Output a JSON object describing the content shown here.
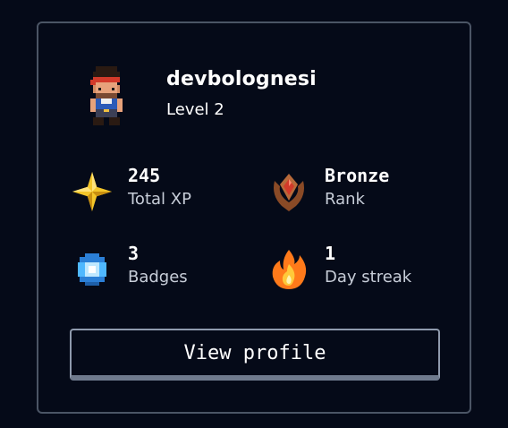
{
  "user": {
    "username": "devbolognesi",
    "level": "Level 2"
  },
  "stats": [
    {
      "value": "245",
      "label": "Total XP",
      "icon": "sparkle-icon"
    },
    {
      "value": "Bronze",
      "label": "Rank",
      "icon": "rank-emblem-icon"
    },
    {
      "value": "3",
      "label": "Badges",
      "icon": "gem-icon"
    },
    {
      "value": "1",
      "label": "Day streak",
      "icon": "flame-icon"
    }
  ],
  "actions": {
    "view_profile_label": "View profile"
  },
  "colors": {
    "background": "#050a18",
    "card_border": "#4b5565",
    "button_border": "#8f9aad",
    "text_primary": "#ffffff",
    "text_secondary": "#c7cdd8",
    "xp_gold": "#f4c62a",
    "gem_blue": "#4fb8ff",
    "flame_orange": "#ff7a1a",
    "bronze": "#b86a3a"
  }
}
